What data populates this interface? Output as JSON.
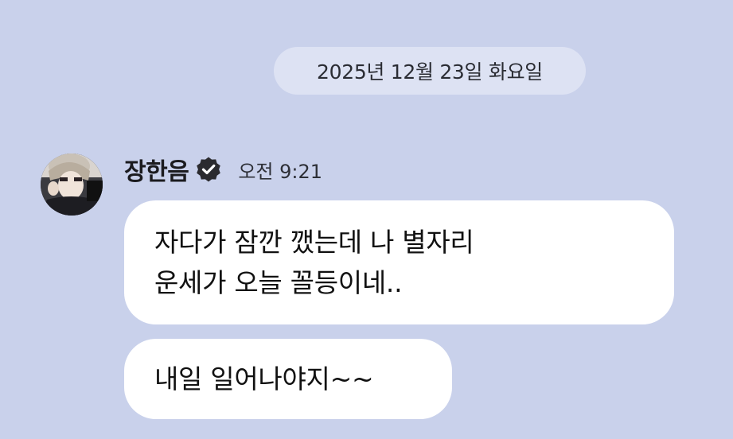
{
  "chat": {
    "date_divider": "2025년 12월 23일 화요일",
    "sender": {
      "name": "장한음",
      "verified_icon": "verified-badge-icon",
      "time": "오전 9:21"
    },
    "messages": [
      {
        "lines": [
          "자다가 잠깐 깼는데 나 별자리",
          "운세가 오늘 꼴등이네.."
        ]
      },
      {
        "lines": [
          "내일 일어나야지~~"
        ]
      }
    ]
  },
  "colors": {
    "background": "#c9d1eb",
    "date_pill": "#dde2f3",
    "bubble": "#ffffff",
    "badge": "#2b2b2f"
  }
}
